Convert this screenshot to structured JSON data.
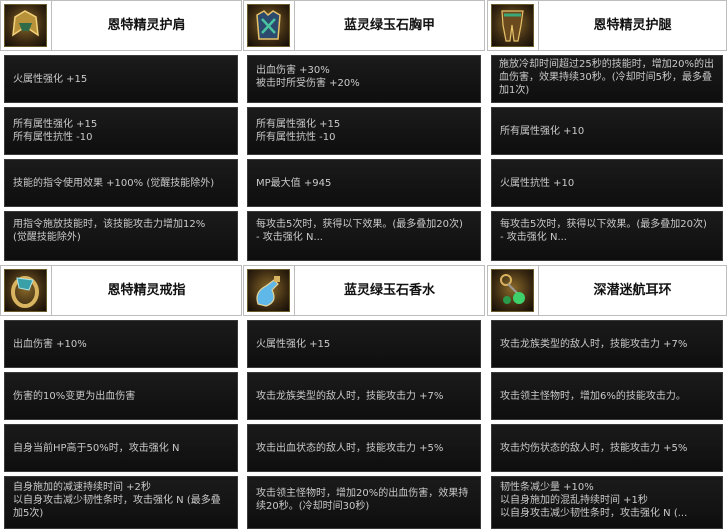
{
  "columns": [
    {
      "top": {
        "icon": "shoulder-armor-icon",
        "title": "恩特精灵护肩",
        "stats": [
          "火属性强化 +15",
          "所有属性强化 +15\n所有属性抗性 -10",
          "技能的指令使用效果 +100% (觉醒技能除外)",
          "用指令施放技能时，该技能攻击力增加12%\n(觉醒技能除外)"
        ]
      },
      "bottom": {
        "icon": "ring-icon",
        "title": "恩特精灵戒指",
        "stats": [
          "出血伤害 +10%",
          "伤害的10%变更为出血伤害",
          "自身当前HP高于50%时，攻击强化 N",
          "自身施加的减速持续时间 +2秒\n以自身攻击减少韧性条时，攻击强化 N (最多叠加5次)"
        ]
      }
    },
    {
      "top": {
        "icon": "chest-armor-icon",
        "title": "蓝灵绿玉石胸甲",
        "stats": [
          "出血伤害 +30%\n被击时所受伤害 +20%",
          "所有属性强化 +15\n所有属性抗性 -10",
          "MP最大值 +945",
          "每攻击5次时，获得以下效果。(最多叠加20次)\n- 攻击强化 N..."
        ]
      },
      "bottom": {
        "icon": "perfume-bottle-icon",
        "title": "蓝灵绿玉石香水",
        "stats": [
          "火属性强化 +15",
          "攻击龙族类型的敌人时，技能攻击力 +7%",
          "攻击出血状态的敌人时，技能攻击力 +5%",
          "攻击领主怪物时，增加20%的出血伤害，效果持续20秒。(冷却时间30秒)"
        ]
      }
    },
    {
      "top": {
        "icon": "leg-armor-icon",
        "title": "恩特精灵护腿",
        "stats": [
          "施放冷却时间超过25秒的技能时，增加20%的出血伤害，效果持续30秒。(冷却时间5秒，最多叠加1次)",
          "所有属性强化 +10",
          "火属性抗性 +10",
          "每攻击5次时，获得以下效果。(最多叠加20次)\n- 攻击强化 N..."
        ]
      },
      "bottom": {
        "icon": "earring-icon",
        "title": "深潜迷航耳环",
        "stats": [
          "攻击龙族类型的敌人时，技能攻击力 +7%",
          "攻击领主怪物时，增加6%的技能攻击力。",
          "攻击灼伤状态的敌人时，技能攻击力 +5%",
          "韧性条减少量 +10%\n以自身施加的混乱持续时间 +1秒\n以自身攻击减少韧性条时，攻击强化 N (..."
        ]
      }
    }
  ]
}
